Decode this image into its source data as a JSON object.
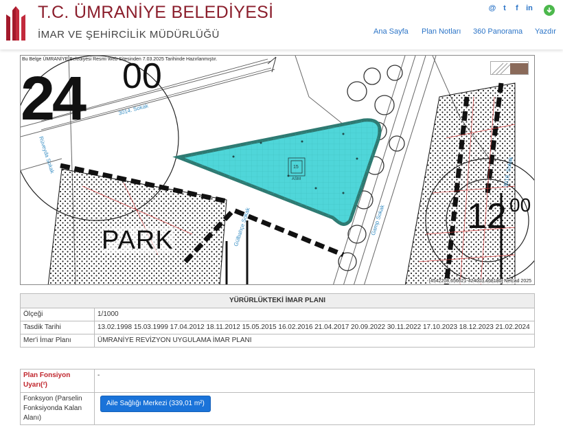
{
  "header": {
    "title": "T.C. ÜMRANİYE BELEDİYESİ",
    "subtitle": "İMAR VE ŞEHİRCİLİK MÜDÜRLÜĞÜ",
    "social": [
      "@",
      "t",
      "f",
      "in"
    ],
    "nav": [
      "Ana Sayfa",
      "Plan Notları",
      "360 Panorama",
      "Yazdır"
    ],
    "accent_color": "#8b1e2c",
    "link_color": "#2b74c7"
  },
  "map": {
    "note": "Bu Belge ÜMRANİYE Belediyesi Resmi Web Sitesinden 7.03.2025 Tarihinde Hazırlanmıştır.",
    "coords": "[4542208.656621-424003.468180] Netcad 2025",
    "labels": {
      "big_num_left": "24",
      "superscript_left": "00",
      "big_num_right": "12",
      "superscript_right": "00",
      "street_3014": "3014. Sokak",
      "street_ruveyda": "Rüveyda Sokak",
      "street_gulbahce": "Gülbahçe Sokak",
      "street_gamp": "Gamp Sokak",
      "street_3018": "3018. Sokak",
      "park": "PARK",
      "parcel_no": "15",
      "asm": "ASM"
    },
    "highlight_color": "#4fd6d9"
  },
  "plan_table": {
    "header": "YÜRÜRLÜKTEKİ İMAR PLANI",
    "rows": [
      {
        "label": "Ölçeği",
        "value": "1/1000"
      },
      {
        "label": "Tasdik Tarihi",
        "value": "13.02.1998 15.03.1999 17.04.2012 18.11.2012 15.05.2015 16.02.2016 21.04.2017 20.09.2022 30.11.2022 17.10.2023 18.12.2023 21.02.2024"
      },
      {
        "label": "Mer'i İmar Planı",
        "value": "ÜMRANİYE REVİZYON UYGULAMA İMAR PLANI"
      }
    ]
  },
  "function_table": {
    "warning_label": "Plan Fonsiyon Uyarı(²)",
    "warning_value": "-",
    "function_label": "Fonksyon (Parselin Fonksiyonda Kalan Alanı)",
    "function_button": "Aile Sağlığı Merkezi (339,01 m²)"
  }
}
